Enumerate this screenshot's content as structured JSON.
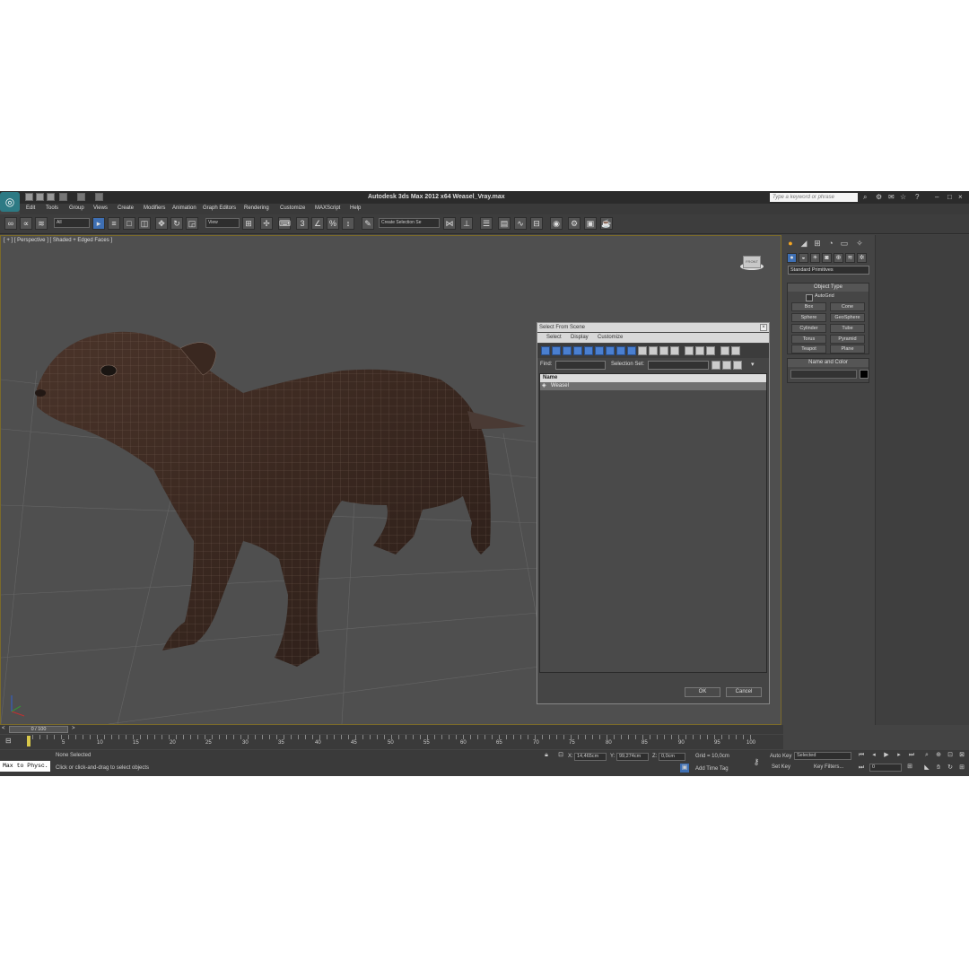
{
  "title": "Autodesk 3ds Max  2012 x64     Weasel_Vray.max",
  "search_placeholder": "Type a keyword or phrase",
  "menu": [
    "Edit",
    "Tools",
    "Group",
    "Views",
    "Create",
    "Modifiers",
    "Animation",
    "Graph Editors",
    "Rendering",
    "Customize",
    "MAXScript",
    "Help"
  ],
  "toolbar": {
    "selection_filter": "All",
    "reference_coord": "View",
    "snap_label": "3",
    "named_selection": "Create Selection Se"
  },
  "viewport": {
    "label": "[ + ] [ Perspective ] [ Shaded + Edged Faces ]",
    "viewcube_label": "FRONT"
  },
  "command_panel": {
    "category": "Standard Primitives",
    "object_type_header": "Object Type",
    "autogrid": "AutoGrid",
    "primitives": [
      "Box",
      "Cone",
      "Sphere",
      "GeoSphere",
      "Cylinder",
      "Tube",
      "Torus",
      "Pyramid",
      "Teapot",
      "Plane"
    ],
    "name_color_header": "Name and Color"
  },
  "dialog": {
    "title": "Select From Scene",
    "menu": [
      "Select",
      "Display",
      "Customize"
    ],
    "find_label": "Find:",
    "selection_set_label": "Selection Set:",
    "column_name": "Name",
    "items": [
      "Weasel"
    ],
    "ok": "OK",
    "cancel": "Cancel"
  },
  "timeline": {
    "frame_counter": "0 / 100",
    "ticks": [
      "5",
      "10",
      "15",
      "20",
      "25",
      "30",
      "35",
      "40",
      "45",
      "50",
      "55",
      "60",
      "65",
      "70",
      "75",
      "80",
      "85",
      "90",
      "95",
      "100"
    ]
  },
  "status": {
    "maxscript_listener": "Max to Physc.",
    "selection": "None Selected",
    "prompt": "Click or click-and-drag to select objects",
    "x_label": "X:",
    "x_value": "14,465cm",
    "y_label": "Y:",
    "y_value": "99,274cm",
    "z_label": "Z:",
    "z_value": "0,0cm",
    "grid": "Grid = 10,0cm",
    "add_time_tag": "Add Time Tag",
    "auto_key": "Auto Key",
    "set_key": "Set Key",
    "key_mode": "Selected",
    "key_filters": "Key Filters...",
    "current_frame": "0"
  },
  "colors": {
    "ui_bg": "#444444",
    "viewport_bg": "#4f4f4f",
    "weasel_fur": "#3b2a22",
    "highlight_blue": "#3e6fb3"
  }
}
